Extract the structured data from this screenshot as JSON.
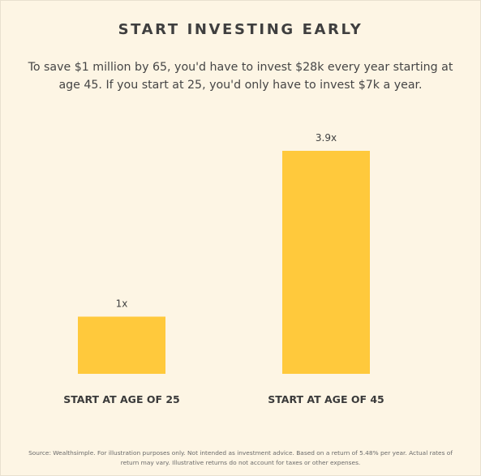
{
  "title": "START INVESTING EARLY",
  "subtitle": "To save $1 million by 65, you'd have to invest $28k every year starting at age 45. If you start at 25, you'd only have to invest $7k a year.",
  "footnote": "Source: Wealthsimple. For illustration purposes only. Not intended as investment advice. Based on a return of 5.48% per year. Actual rates of return may vary. Illustrative returns do not account for taxes or other expenses.",
  "colors": {
    "bar": "#ffc93c",
    "background": "#fdf5e4",
    "text": "#3f3f3f"
  },
  "chart_data": {
    "type": "bar",
    "title": "START INVESTING EARLY",
    "categories": [
      "START AT AGE OF 25",
      "START AT AGE OF 45"
    ],
    "values": [
      1,
      3.9
    ],
    "data_labels": [
      "1x",
      "3.9x"
    ],
    "ylim": [
      0,
      3.9
    ],
    "grid": false,
    "legend": "none"
  }
}
